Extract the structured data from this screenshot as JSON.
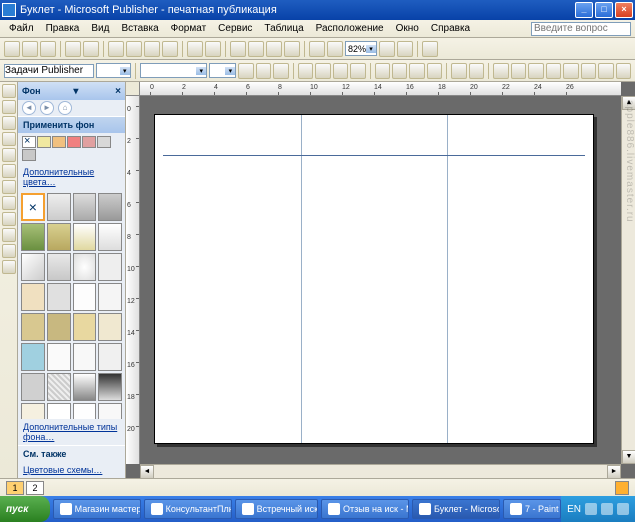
{
  "window": {
    "title": "Буклет - Microsoft Publisher - печатная публикация"
  },
  "menu": {
    "file": "Файл",
    "edit": "Правка",
    "view": "Вид",
    "insert": "Вставка",
    "format": "Формат",
    "tools": "Сервис",
    "table": "Таблица",
    "arrange": "Расположение",
    "window": "Окно",
    "help": "Справка",
    "ask_placeholder": "Введите вопрос"
  },
  "toolbar": {
    "tasklabel": "Задачи Publisher",
    "zoom": "82%"
  },
  "taskpane": {
    "title": "Фон",
    "apply": "Применить фон",
    "more_colors": "Дополнительные цвета…",
    "more_types": "Дополнительные типы фона…",
    "see_also": "См. также",
    "color_schemes": "Цветовые схемы…",
    "swatches": [
      "#ffffff",
      "#f0e8a0",
      "#f0c080",
      "#f08080",
      "#e08080",
      "#d8d8d8",
      "#c8c8c8",
      "#b8b8b8"
    ]
  },
  "pages": {
    "p1": "1",
    "p2": "2"
  },
  "ruler_h": [
    "0",
    "2",
    "4",
    "6",
    "8",
    "10",
    "12",
    "14",
    "16",
    "18",
    "20",
    "22",
    "24",
    "26"
  ],
  "ruler_v": [
    "0",
    "2",
    "4",
    "6",
    "8",
    "10",
    "12",
    "14",
    "16",
    "18",
    "20"
  ],
  "taskbar": {
    "start": "пуск",
    "t1": "Магазин мастера Ап…",
    "t2": "КонсультантПлюс -…",
    "t3": "Встречный иск",
    "t4": "Отзыв на иск - Micr…",
    "t5": "Буклет - Microsoft P…",
    "t6": "7 - Paint",
    "lang": "EN"
  },
  "watermark": "apple886.livemaster.ru"
}
